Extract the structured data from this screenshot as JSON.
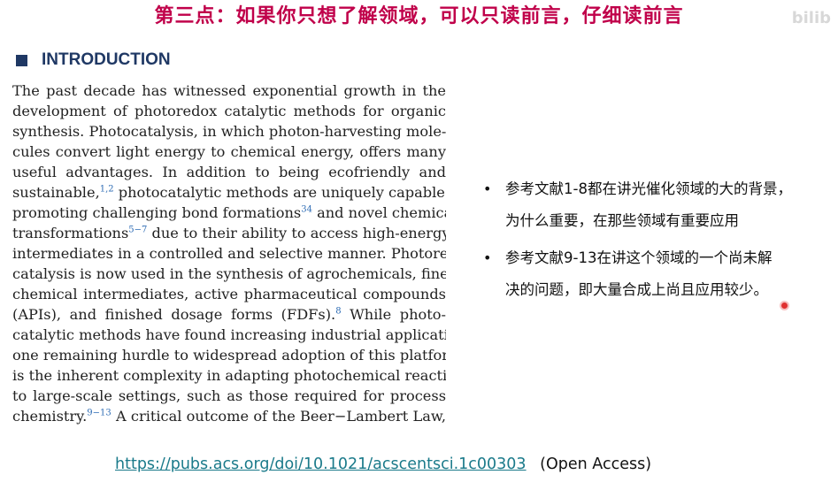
{
  "slide_title": "第三点：如果你只想了解领域，可以只读前言，仔细读前言",
  "watermark": "bilib",
  "section_heading": "INTRODUCTION",
  "paper_lines": [
    [
      {
        "t": "The past decade has witnessed exponential growth in the"
      }
    ],
    [
      {
        "t": "development of photoredox catalytic methods for organic"
      }
    ],
    [
      {
        "t": "synthesis. Photocatalysis, in which photon-harvesting mole-"
      }
    ],
    [
      {
        "t": "cules convert light energy to chemical energy, offers many"
      }
    ],
    [
      {
        "t": "useful advantages. In addition to being ecofriendly and"
      }
    ],
    [
      {
        "t": "sustainable,"
      },
      {
        "c": "1,2"
      },
      {
        "t": " photocatalytic methods are uniquely capable of"
      }
    ],
    [
      {
        "t": "promoting challenging bond formations"
      },
      {
        "c": "34"
      },
      {
        "t": " and novel chemical"
      }
    ],
    [
      {
        "t": "transformations"
      },
      {
        "c": "5−7"
      },
      {
        "t": " due to their ability to access high-energy"
      }
    ],
    [
      {
        "t": "intermediates in a controlled and selective manner. Photoredox"
      }
    ],
    [
      {
        "t": "catalysis is now used in the synthesis of agrochemicals, fine"
      }
    ],
    [
      {
        "t": "chemical intermediates, active pharmaceutical compounds"
      }
    ],
    [
      {
        "t": "(APIs), and finished dosage forms (FDFs)."
      },
      {
        "c": "8"
      },
      {
        "t": " While photo-"
      }
    ],
    [
      {
        "t": "catalytic methods have found increasing industrial application,"
      }
    ],
    [
      {
        "t": "one remaining hurdle to widespread adoption of this platform"
      }
    ],
    [
      {
        "t": "is the inherent complexity in adapting photochemical reactions"
      }
    ],
    [
      {
        "t": "to large-scale settings, such as those required for process"
      }
    ],
    [
      {
        "t": "chemistry."
      },
      {
        "c": "9−13"
      },
      {
        "t": " A critical outcome of the Beer−Lambert Law,"
      }
    ]
  ],
  "notes": [
    {
      "lines": [
        "参考文献1-8都在讲光催化领域的大的背景，",
        "为什么重要，在那些领域有重要应用"
      ]
    },
    {
      "lines": [
        "参考文献9-13在讲这个领域的一个尚未解",
        "决的问题，即大量合成上尚且应用较少。"
      ]
    }
  ],
  "bullet_char": "•",
  "link": {
    "url": "https://pubs.acs.org/doi/10.1021/acscentsci.1c00303",
    "note": "(Open Access)"
  },
  "colors": {
    "title": "#c0004a",
    "heading": "#1f3864",
    "citation": "#2f6db5",
    "link": "#1a7a8a"
  }
}
